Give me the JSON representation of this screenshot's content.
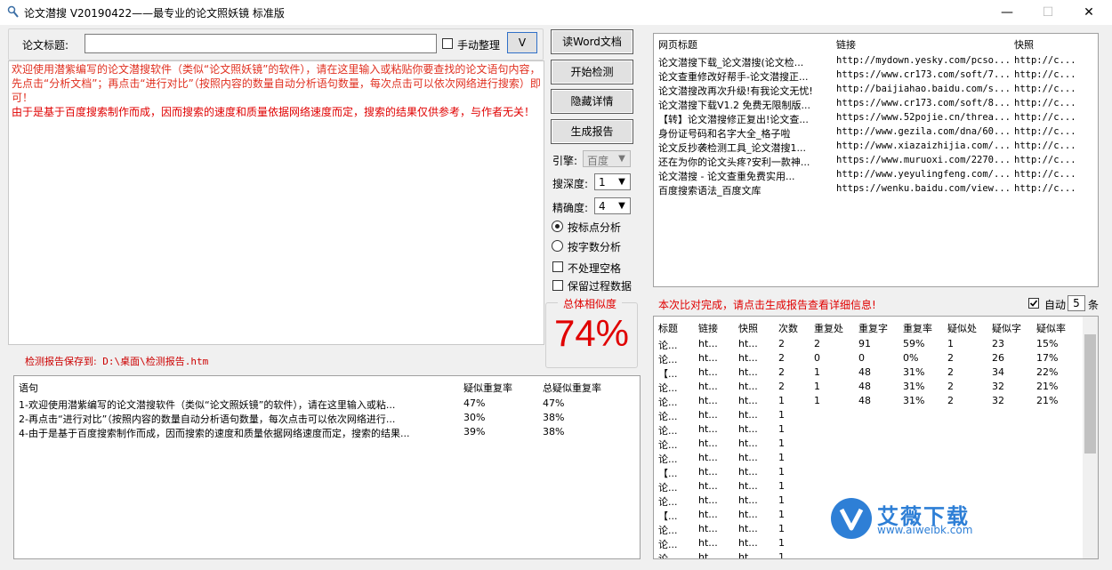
{
  "window": {
    "title": "论文潜搜  V20190422——最专业的论文照妖镜 标准版",
    "minimize_glyph": "—",
    "maximize_glyph": "☐",
    "close_glyph": "✕"
  },
  "paper_title": {
    "label": "论文标题:",
    "value": "",
    "manual_label": "手动整理",
    "manual_checked": false,
    "dropdown_glyph": "V"
  },
  "intro_text": {
    "line1": "欢迎使用潜紫编写的论文潜搜软件（类似“论文照妖镜”的软件），请在这里输入或粘贴你要查找的论文语句内容，先点击“分析文档”；再点击“进行对比”（按照内容的数量自动分析语句数量，每次点击可以依次网络进行搜索）即可！",
    "line2": "由于是基于百度搜索制作而成，因而搜索的速度和质量依据网络速度而定，搜索的结果仅供参考，与作者无关！"
  },
  "save_path": {
    "label": "检测报告保存到:",
    "path": "D:\\桌面\\检测报告.htm"
  },
  "buttons": {
    "read_word": "读Word文档",
    "start": "开始检测",
    "hide": "隐藏详情",
    "report": "生成报告"
  },
  "options": {
    "engine_label": "引擎:",
    "engine_value": "百度",
    "depth_label": "搜深度:",
    "depth_value": "1",
    "precision_label": "精确度:",
    "precision_value": "4",
    "radio_punct": "按标点分析",
    "radio_chars": "按字数分析",
    "radio_selected": "punct",
    "chk_space": "不处理空格",
    "chk_keep": "保留过程数据"
  },
  "similarity": {
    "label": "总体相似度",
    "value": "74%"
  },
  "sentences": {
    "headers": [
      "语句",
      "疑似重复率",
      "总疑似重复率"
    ],
    "rows": [
      [
        "1-欢迎使用潜紫编写的论文潜搜软件（类似“论文照妖镜”的软件），请在这里输入或粘...",
        "47%",
        "47%"
      ],
      [
        "2-再点击“进行对比”（按照内容的数量自动分析语句数量，每次点击可以依次网络进行...",
        "30%",
        "38%"
      ],
      [
        "4-由于是基于百度搜索制作而成，因而搜索的速度和质量依据网络速度而定，搜索的结果...",
        "39%",
        "38%"
      ]
    ]
  },
  "web_results": {
    "headers": [
      "网页标题",
      "链接",
      "快照"
    ],
    "rows": [
      [
        "论文潜搜下载_论文潜搜(论文检...",
        "http://mydown.yesky.com/pcso...",
        "http://c..."
      ],
      [
        "论文查重修改好帮手-论文潜搜正...",
        "https://www.cr173.com/soft/7...",
        "http://c..."
      ],
      [
        "论文潜搜改再次升级!有我论文无忧!",
        "http://baijiahao.baidu.com/s...",
        "http://c..."
      ],
      [
        "论文潜搜下载V1.2 免费无限制版...",
        "https://www.cr173.com/soft/8...",
        "http://c..."
      ],
      [
        "【转】论文潜搜修正复出!论文查...",
        "https://www.52pojie.cn/threa...",
        "http://c..."
      ],
      [
        "身份证号码和名字大全_格子啦",
        "http://www.gezila.com/dna/60...",
        "http://c..."
      ],
      [
        "论文反抄袭检测工具_论文潜搜1...",
        "http://www.xiazaizhijia.com/...",
        "http://c..."
      ],
      [
        "还在为你的论文头疼?安利一款神...",
        "https://www.muruoxi.com/2270...",
        "http://c..."
      ],
      [
        "论文潜搜 - 论文查重免费实用...",
        "http://www.yeyulingfeng.com/...",
        "http://c..."
      ],
      [
        "百度搜索语法_百度文库",
        "https://wenku.baidu.com/view...",
        "http://c..."
      ]
    ]
  },
  "status": {
    "message": "本次比对完成，请点击生成报告查看详细信息!",
    "auto_label": "自动",
    "auto_checked": true,
    "auto_count": "5",
    "auto_unit": "条"
  },
  "detail": {
    "headers": [
      "标题",
      "链接",
      "快照",
      "次数",
      "重复处",
      "重复字",
      "重复率",
      "疑似处",
      "疑似字",
      "疑似率"
    ],
    "rows": [
      [
        "论...",
        "ht...",
        "ht...",
        "2",
        "2",
        "91",
        "59%",
        "1",
        "23",
        "15%"
      ],
      [
        "论...",
        "ht...",
        "ht...",
        "2",
        "0",
        "0",
        "0%",
        "2",
        "26",
        "17%"
      ],
      [
        "【...",
        "ht...",
        "ht...",
        "2",
        "1",
        "48",
        "31%",
        "2",
        "34",
        "22%"
      ],
      [
        "论...",
        "ht...",
        "ht...",
        "2",
        "1",
        "48",
        "31%",
        "2",
        "32",
        "21%"
      ],
      [
        "论...",
        "ht...",
        "ht...",
        "1",
        "1",
        "48",
        "31%",
        "2",
        "32",
        "21%"
      ],
      [
        "论...",
        "ht...",
        "ht...",
        "1",
        "",
        "",
        "",
        "",
        "",
        ""
      ],
      [
        "论...",
        "ht...",
        "ht...",
        "1",
        "",
        "",
        "",
        "",
        "",
        ""
      ],
      [
        "论...",
        "ht...",
        "ht...",
        "1",
        "",
        "",
        "",
        "",
        "",
        ""
      ],
      [
        "论...",
        "ht...",
        "ht...",
        "1",
        "",
        "",
        "",
        "",
        "",
        ""
      ],
      [
        "【...",
        "ht...",
        "ht...",
        "1",
        "",
        "",
        "",
        "",
        "",
        ""
      ],
      [
        "论...",
        "ht...",
        "ht...",
        "1",
        "",
        "",
        "",
        "",
        "",
        ""
      ],
      [
        "论...",
        "ht...",
        "ht...",
        "1",
        "",
        "",
        "",
        "",
        "",
        ""
      ],
      [
        "【...",
        "ht...",
        "ht...",
        "1",
        "",
        "",
        "",
        "",
        "",
        ""
      ],
      [
        "论...",
        "ht...",
        "ht...",
        "1",
        "",
        "",
        "",
        "",
        "",
        ""
      ],
      [
        "论...",
        "ht...",
        "ht...",
        "1",
        "",
        "",
        "",
        "",
        "",
        ""
      ],
      [
        "论...",
        "ht...",
        "ht...",
        "1",
        "",
        "",
        "",
        "",
        "",
        ""
      ]
    ]
  },
  "watermark": {
    "name": "艾薇下载",
    "url": "www.aiweibk.com"
  }
}
